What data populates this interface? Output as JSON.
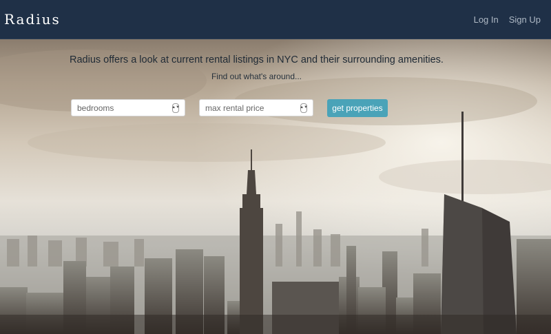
{
  "navbar": {
    "brand": "Radius",
    "links": [
      {
        "label": "Log In"
      },
      {
        "label": "Sign Up"
      }
    ]
  },
  "hero": {
    "headline": "Radius offers a look at current rental listings in NYC and their surrounding amenities.",
    "subline": "Find out what's around...",
    "bedrooms_placeholder": "bedrooms",
    "price_placeholder": "max rental price",
    "submit_label": "get properties",
    "background": "nyc-skyline-photo"
  },
  "colors": {
    "navbar": "#1f3047",
    "button": "#4aa3b8"
  }
}
